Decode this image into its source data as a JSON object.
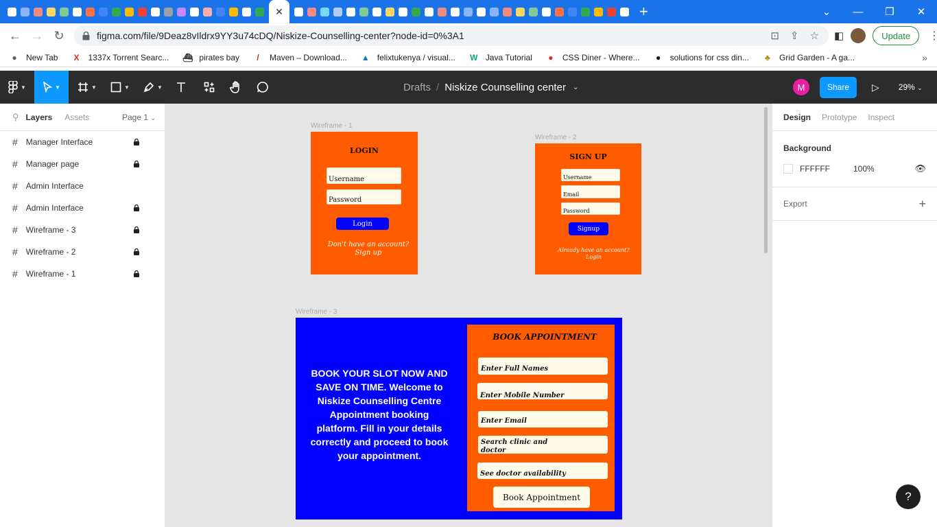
{
  "browser": {
    "active_tab_close": "✕",
    "new_tab": "+",
    "url": "figma.com/file/9Deaz8vIldrx9YY3u74cDQ/Niskize-Counselling-center?node-id=0%3A1",
    "update_label": "Update",
    "bookmarks": [
      {
        "label": "New Tab",
        "icon": "globe-icon",
        "color": "#5f6368",
        "glyph": "●"
      },
      {
        "label": "1337x Torrent Searc...",
        "icon": "1337x-icon",
        "color": "#d93025",
        "glyph": "X"
      },
      {
        "label": "pirates bay",
        "icon": "pirate-ship-icon",
        "color": "#333333",
        "glyph": "⛴"
      },
      {
        "label": "Maven – Download...",
        "icon": "maven-feather-icon",
        "color": "#c62828",
        "glyph": "/"
      },
      {
        "label": "felixtukenya / visual...",
        "icon": "azure-devops-icon",
        "color": "#0078d4",
        "glyph": "▲"
      },
      {
        "label": "Java Tutorial",
        "icon": "w3schools-icon",
        "color": "#04aa6d",
        "glyph": "W"
      },
      {
        "label": "CSS Diner - Where...",
        "icon": "css-diner-icon",
        "color": "#d93025",
        "glyph": "●"
      },
      {
        "label": "solutions for css din...",
        "icon": "github-icon",
        "color": "#111111",
        "glyph": "●"
      },
      {
        "label": "Grid Garden - A ga...",
        "icon": "grid-garden-icon",
        "color": "#b8860b",
        "glyph": "♣"
      }
    ],
    "bookmarks_more": "»"
  },
  "figma": {
    "drafts": "Drafts",
    "file_name": "Niskize Counselling center",
    "user_initial": "M",
    "share_label": "Share",
    "zoom": "29%"
  },
  "left_panel": {
    "tab_layers": "Layers",
    "tab_assets": "Assets",
    "page": "Page 1",
    "layers": [
      {
        "name": "Manager Interface",
        "locked": true
      },
      {
        "name": "Manager page",
        "locked": true
      },
      {
        "name": "Admin Interface",
        "locked": false
      },
      {
        "name": "Admin Interface",
        "locked": true
      },
      {
        "name": "Wireframe - 3",
        "locked": true
      },
      {
        "name": "Wireframe - 2",
        "locked": true
      },
      {
        "name": "Wireframe - 1",
        "locked": true
      }
    ]
  },
  "canvas": {
    "wf1": {
      "label": "Wireframe - 1",
      "title": "LOGIN",
      "username": "Username",
      "password": "Password",
      "button": "Login",
      "link_line1": "Don't have an account?",
      "link_line2": "Sign up"
    },
    "wf2": {
      "label": "Wireframe - 2",
      "title": "SIGN UP",
      "username": "Username",
      "email": "Email",
      "password": "Password",
      "button": "Signup",
      "link_line1": "Already have an account?",
      "link_line2": "Login"
    },
    "wf3": {
      "label": "Wireframe - 3",
      "promo": "BOOK YOUR SLOT NOW AND SAVE ON TIME. Welcome to Niskize Counselling Centre Appointment booking platform. Fill in your details correctly and proceed to book your appointment.",
      "form_title": "BOOK APPOINTMENT",
      "full_names": "Enter Full Names",
      "mobile": "Enter Mobile Number",
      "email": "Enter Email",
      "search_clinic": "Search clinic and doctor",
      "availability": "See doctor availability",
      "button": "Book Appointment"
    }
  },
  "right_panel": {
    "tab_design": "Design",
    "tab_prototype": "Prototype",
    "tab_inspect": "Inspect",
    "background_heading": "Background",
    "background_hex": "FFFFFF",
    "background_opacity": "100%",
    "export_heading": "Export"
  },
  "help": "?"
}
